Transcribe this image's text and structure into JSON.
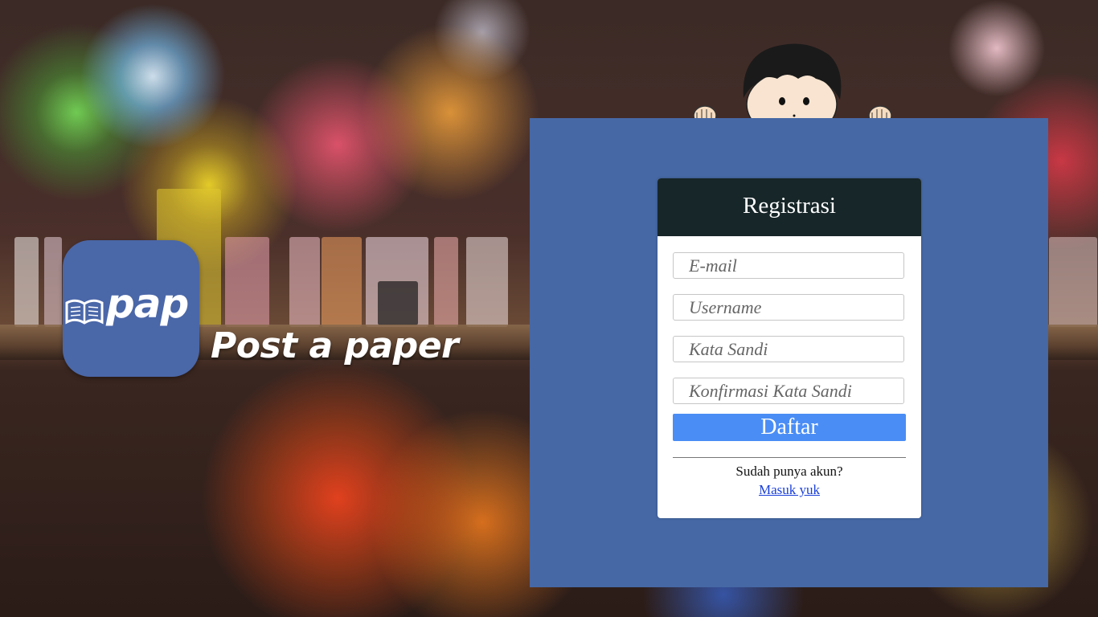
{
  "branding": {
    "logo_text": "pap",
    "tagline": "Post a paper"
  },
  "register_form": {
    "title": "Registrasi",
    "email_placeholder": "E-mail",
    "username_placeholder": "Username",
    "password_placeholder": "Kata Sandi",
    "confirm_password_placeholder": "Konfirmasi Kata Sandi",
    "submit_label": "Daftar",
    "have_account_text": "Sudah punya akun?",
    "login_link": "Masuk yuk"
  },
  "colors": {
    "panel": "#4668a5",
    "card_header": "#172629",
    "button": "#4a8df5",
    "logo_tile": "#4a67a8",
    "link": "#1a3fd8"
  }
}
